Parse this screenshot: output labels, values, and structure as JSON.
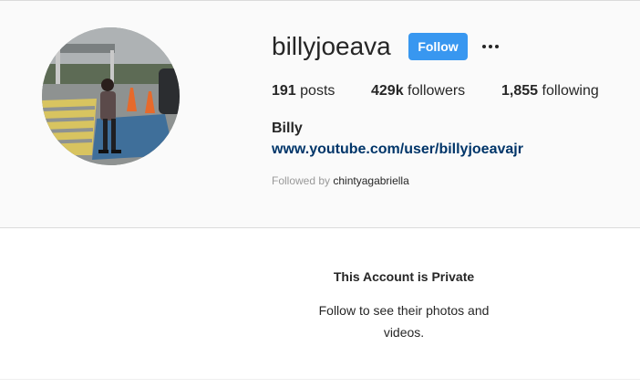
{
  "profile": {
    "username": "billyjoeava",
    "follow_label": "Follow",
    "more_icon": "more-options-icon",
    "posts_count": "191",
    "posts_label": "posts",
    "followers_count": "429k",
    "followers_label": "followers",
    "following_count": "1,855",
    "following_label": "following",
    "full_name": "Billy",
    "website": "www.youtube.com/user/billyjoeavajr",
    "followed_by_prefix": "Followed by",
    "followed_by_user": "chintyagabriella"
  },
  "private_notice": {
    "title": "This Account is Private",
    "subtitle": "Follow to see their photos and videos."
  },
  "colors": {
    "accent": "#3897f0",
    "link": "#003569",
    "header_bg": "#fafafa",
    "border": "#dbdbdb"
  }
}
